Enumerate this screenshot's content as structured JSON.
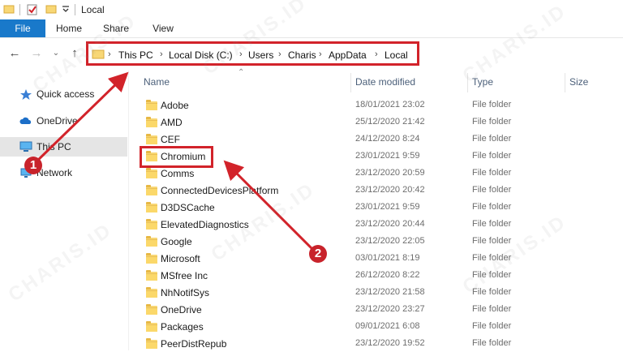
{
  "window": {
    "title": "Local"
  },
  "ribbon": {
    "tabs": [
      "File",
      "Home",
      "Share",
      "View"
    ]
  },
  "address": {
    "crumbs": [
      "This PC",
      "Local Disk (C:)",
      "Users",
      "Charis",
      "AppData",
      "Local"
    ]
  },
  "sidebar": {
    "items": [
      {
        "label": "Quick access",
        "icon": "star-icon"
      },
      {
        "label": "OneDrive",
        "icon": "cloud-icon"
      },
      {
        "label": "This PC",
        "icon": "computer-icon",
        "selected": true
      },
      {
        "label": "Network",
        "icon": "network-icon"
      }
    ]
  },
  "columns": {
    "name": "Name",
    "date": "Date modified",
    "type": "Type",
    "size": "Size"
  },
  "files": [
    {
      "name": "Adobe",
      "date": "18/01/2021 23:02",
      "type": "File folder"
    },
    {
      "name": "AMD",
      "date": "25/12/2020 21:42",
      "type": "File folder"
    },
    {
      "name": "CEF",
      "date": "24/12/2020 8:24",
      "type": "File folder"
    },
    {
      "name": "Chromium",
      "date": "23/01/2021 9:59",
      "type": "File folder"
    },
    {
      "name": "Comms",
      "date": "23/12/2020 20:59",
      "type": "File folder"
    },
    {
      "name": "ConnectedDevicesPlatform",
      "date": "23/12/2020 20:42",
      "type": "File folder"
    },
    {
      "name": "D3DSCache",
      "date": "23/01/2021 9:59",
      "type": "File folder"
    },
    {
      "name": "ElevatedDiagnostics",
      "date": "23/12/2020 20:44",
      "type": "File folder"
    },
    {
      "name": "Google",
      "date": "23/12/2020 22:05",
      "type": "File folder"
    },
    {
      "name": "Microsoft",
      "date": "03/01/2021 8:19",
      "type": "File folder"
    },
    {
      "name": "MSfree Inc",
      "date": "26/12/2020 8:22",
      "type": "File folder"
    },
    {
      "name": "NhNotifSys",
      "date": "23/12/2020 21:58",
      "type": "File folder"
    },
    {
      "name": "OneDrive",
      "date": "23/12/2020 23:27",
      "type": "File folder"
    },
    {
      "name": "Packages",
      "date": "09/01/2021 6:08",
      "type": "File folder"
    },
    {
      "name": "PeerDistRepub",
      "date": "23/12/2020 19:52",
      "type": "File folder"
    }
  ],
  "annotations": {
    "marker1": "1",
    "marker2": "2"
  },
  "watermark": "CHARIS.ID",
  "colors": {
    "accent": "#1979ca",
    "annotation_red": "#d2232a",
    "folder": "#f8d775"
  }
}
